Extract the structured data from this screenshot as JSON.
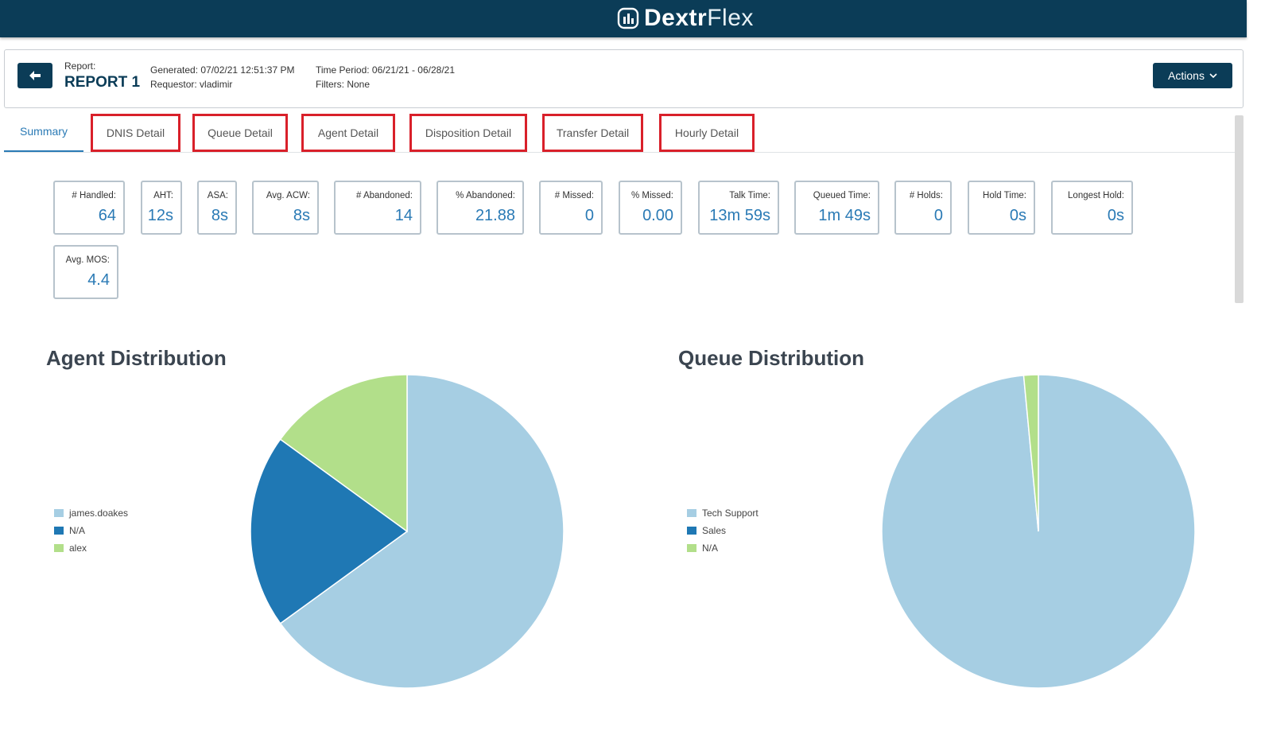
{
  "brand": {
    "name_bold": "Dextr",
    "name_light": "Flex",
    "icon": "chart-bars-logo-icon"
  },
  "report": {
    "label": "Report:",
    "name": "REPORT 1",
    "generated": "Generated: 07/02/21 12:51:37 PM",
    "requestor": "Requestor: vladimir",
    "time_period": "Time Period: 06/21/21 - 06/28/21",
    "filters": "Filters: None",
    "actions_label": "Actions",
    "back_icon": "arrow-left-icon",
    "actions_icon": "chevron-down-icon"
  },
  "tabs": [
    {
      "label": "Summary",
      "active": true,
      "highlighted": false
    },
    {
      "label": "DNIS Detail",
      "active": false,
      "highlighted": true
    },
    {
      "label": "Queue Detail",
      "active": false,
      "highlighted": true
    },
    {
      "label": "Agent Detail",
      "active": false,
      "highlighted": true
    },
    {
      "label": "Disposition Detail",
      "active": false,
      "highlighted": true
    },
    {
      "label": "Transfer Detail",
      "active": false,
      "highlighted": true
    },
    {
      "label": "Hourly Detail",
      "active": false,
      "highlighted": true
    }
  ],
  "stats": [
    {
      "label": "# Handled:",
      "value": "64"
    },
    {
      "label": "AHT:",
      "value": "12s"
    },
    {
      "label": "ASA:",
      "value": "8s"
    },
    {
      "label": "Avg. ACW:",
      "value": "8s"
    },
    {
      "label": "# Abandoned:",
      "value": "14"
    },
    {
      "label": "% Abandoned:",
      "value": "21.88"
    },
    {
      "label": "# Missed:",
      "value": "0"
    },
    {
      "label": "% Missed:",
      "value": "0.00"
    },
    {
      "label": "Talk Time:",
      "value": "13m 59s"
    },
    {
      "label": "Queued Time:",
      "value": "1m 49s"
    },
    {
      "label": "# Holds:",
      "value": "0"
    },
    {
      "label": "Hold Time:",
      "value": "0s"
    },
    {
      "label": "Longest Hold:",
      "value": "0s"
    },
    {
      "label": "Avg. MOS:",
      "value": "4.4"
    }
  ],
  "colors": {
    "navy": "#0b3c57",
    "accent": "#2a7ab5",
    "highlight_box": "#d9202a",
    "light_blue": "#a6cee3",
    "dark_blue": "#1f78b4",
    "light_green": "#b2df8a"
  },
  "chart_data": [
    {
      "type": "pie",
      "title": "Agent Distribution",
      "categories": [
        "james.doakes",
        "N/A",
        "alex"
      ],
      "values": [
        65,
        20,
        15
      ],
      "colors": [
        "#a6cee3",
        "#1f78b4",
        "#b2df8a"
      ],
      "legend": "left"
    },
    {
      "type": "pie",
      "title": "Queue Distribution",
      "categories": [
        "Tech Support",
        "Sales",
        "N/A"
      ],
      "values": [
        98.5,
        0,
        1.5
      ],
      "colors": [
        "#a6cee3",
        "#1f78b4",
        "#b2df8a"
      ],
      "legend": "left"
    }
  ]
}
